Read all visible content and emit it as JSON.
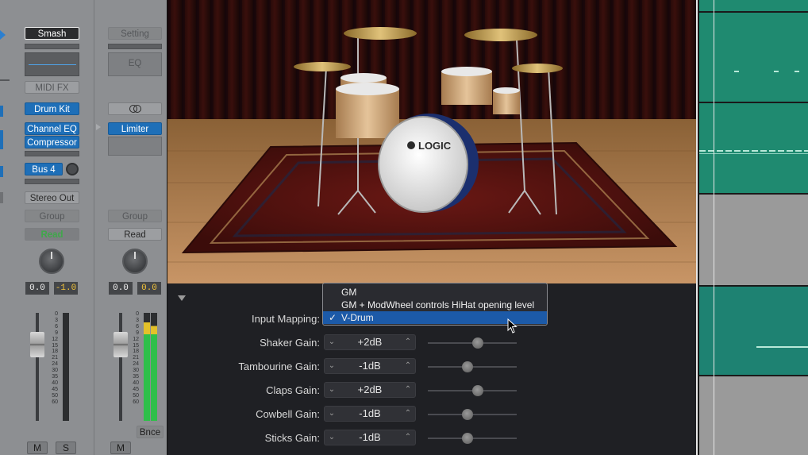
{
  "mixer": {
    "strip1": {
      "setting_label": "Smash",
      "midi_fx_label": "MIDI FX",
      "instrument_label": "Drum Kit",
      "audio_fx": [
        "Channel EQ",
        "Compressor"
      ],
      "send_label": "Bus 4",
      "output_label": "Stereo Out",
      "group_label": "Group",
      "automation_label": "Read",
      "volume_value": "0.0",
      "peak_value": "-1.0",
      "mute_label": "M",
      "solo_label": "S"
    },
    "strip2": {
      "setting_label": "Setting",
      "eq_label": "EQ",
      "link_icon": "stereo-link-icon",
      "audio_fx": [
        "Limiter"
      ],
      "group_label": "Group",
      "automation_label": "Read",
      "volume_value": "0.0",
      "peak_value": "0.0",
      "bounce_label": "Bnce",
      "mute_label": "M"
    },
    "meter_scale": [
      "0",
      "3",
      "6",
      "9",
      "12",
      "15",
      "18",
      "21",
      "24",
      "30",
      "35",
      "40",
      "45",
      "50",
      "60"
    ],
    "meter_scale2": [
      "0",
      "3",
      "6",
      "9",
      "12",
      "15",
      "18",
      "21",
      "24",
      "30",
      "35",
      "40",
      "45",
      "50",
      "60"
    ]
  },
  "plugin": {
    "kit_brand": "LOGIC",
    "disclosure_icon": "disclosure-triangle-icon",
    "input_mapping": {
      "label": "Input Mapping:",
      "options": [
        "GM",
        "GM + ModWheel controls HiHat opening level",
        "V-Drum"
      ],
      "selected": "V-Drum",
      "check": "✓"
    },
    "params": [
      {
        "label": "Shaker Gain:",
        "value": "+2dB",
        "level": 0.56
      },
      {
        "label": "Tambourine Gain:",
        "value": "-1dB",
        "level": 0.45
      },
      {
        "label": "Claps Gain:",
        "value": "+2dB",
        "level": 0.56
      },
      {
        "label": "Cowbell Gain:",
        "value": "-1dB",
        "level": 0.45
      },
      {
        "label": "Sticks Gain:",
        "value": "-1dB",
        "level": 0.45
      }
    ]
  },
  "colors": {
    "accent_blue": "#1e6fb8",
    "region_green": "#1f8a70",
    "region_gray": "#9a9a9a",
    "automation_read": "#3fa84a",
    "peak_yellow": "#f0c23a"
  }
}
